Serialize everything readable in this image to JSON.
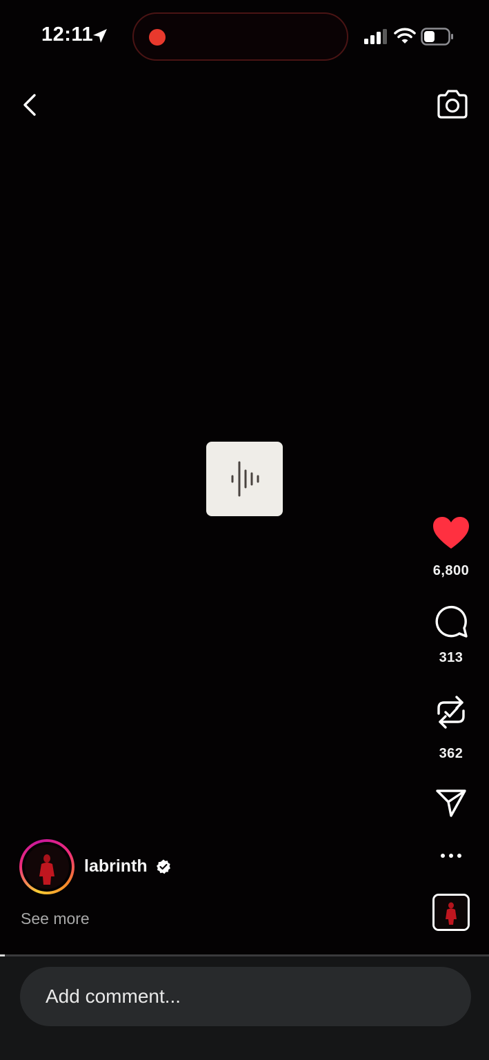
{
  "status_bar": {
    "time": "12:11",
    "icons": [
      "location-arrow-icon",
      "recording-dot-icon",
      "cellular-signal-icon",
      "wifi-icon",
      "battery-icon"
    ]
  },
  "header": {
    "back_icon": "chevron-left-icon",
    "camera_icon": "camera-icon"
  },
  "media": {
    "audio_icon": "audio-waveform-icon"
  },
  "actions": {
    "like_count": "6,800",
    "comment_count": "313",
    "repost_count": "362",
    "like_color": "#ff3040"
  },
  "author": {
    "username": "labrinth",
    "verified": true,
    "see_more": "See more"
  },
  "progress": {
    "fraction": 0.01
  },
  "comment_box": {
    "placeholder": "Add comment..."
  }
}
